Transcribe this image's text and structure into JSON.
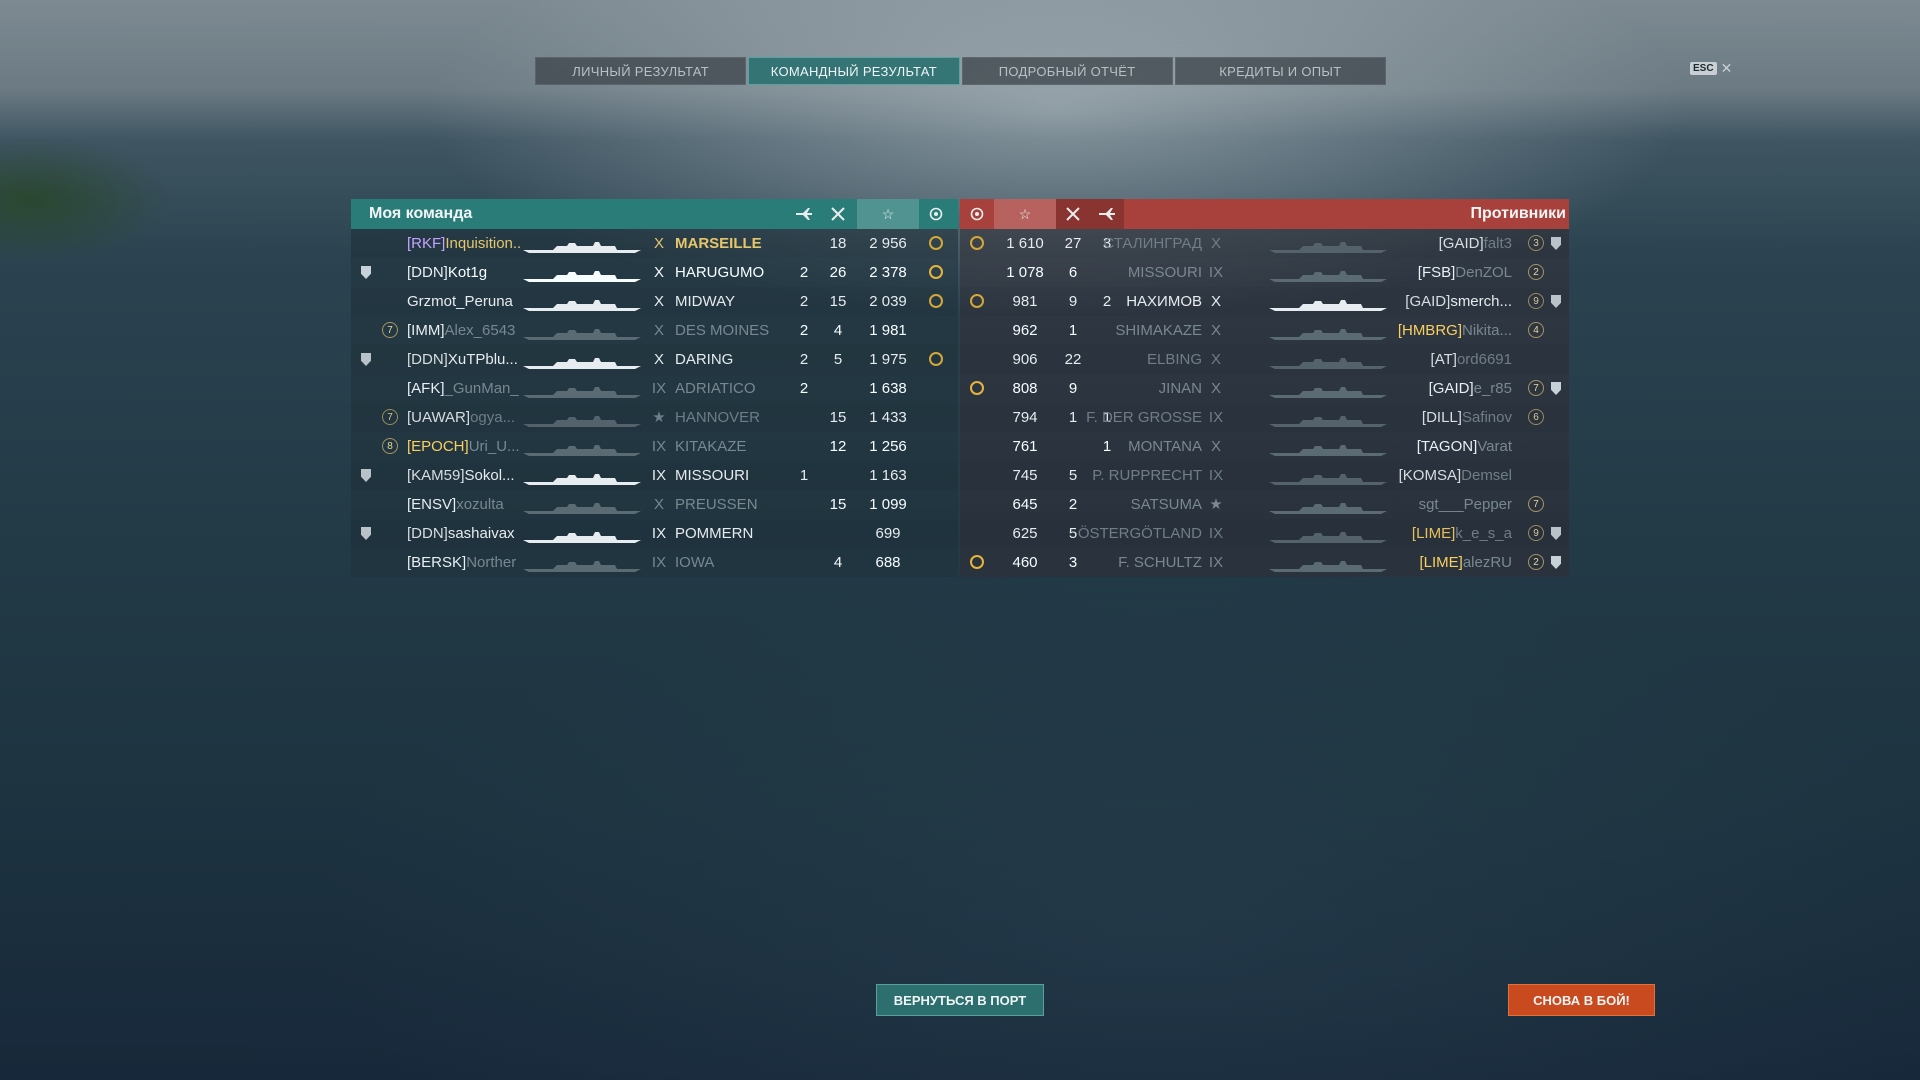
{
  "tabs": [
    "ЛИЧНЫЙ РЕЗУЛЬТАТ",
    "КОМАНДНЫЙ РЕЗУЛЬТАТ",
    "ПОДРОБНЫЙ ОТЧЁТ",
    "КРЕДИТЫ И ОПЫТ"
  ],
  "active_tab": 1,
  "esc": {
    "key": "ESC",
    "close": "✕"
  },
  "my_team": {
    "title": "Моя команда",
    "headers": {
      "planes_icon": "plane-icon",
      "frags_icon": "crossed-swords-icon",
      "xp_icon": "star-icon",
      "medal_icon": "medal-icon"
    },
    "rows": [
      {
        "clan": "[RKF]",
        "name": "Inquisition...",
        "tier": "X",
        "ship": "MARSEILLE",
        "planes": "",
        "frags": "18",
        "xp": "2 956",
        "medal": true,
        "style": "highlight",
        "left_icon": "",
        "dimmed": false
      },
      {
        "clan": "[DDN]",
        "name": "Kot1g",
        "tier": "X",
        "ship": "HARUGUMO",
        "planes": "2",
        "frags": "26",
        "xp": "2 378",
        "medal": true,
        "style": "",
        "left_icon": "shield",
        "dimmed": false
      },
      {
        "clan": "",
        "name": "Grzmot_Peruna",
        "tier": "X",
        "ship": "MIDWAY",
        "planes": "2",
        "frags": "15",
        "xp": "2 039",
        "medal": true,
        "style": "",
        "left_icon": "",
        "dimmed": false
      },
      {
        "clan": "[IMM]",
        "name": "Alex_6543",
        "tier": "X",
        "ship": "DES MOINES",
        "planes": "2",
        "frags": "4",
        "xp": "1 981",
        "medal": false,
        "style": "",
        "left_icon": "badge-7",
        "dimmed": true
      },
      {
        "clan": "[DDN]",
        "name": "XuTPblu...",
        "tier": "X",
        "ship": "DARING",
        "planes": "2",
        "frags": "5",
        "xp": "1 975",
        "medal": true,
        "style": "",
        "left_icon": "shield",
        "dimmed": false
      },
      {
        "clan": "[AFK]",
        "name": "_GunMan_",
        "tier": "IX",
        "ship": "ADRIATICO",
        "planes": "2",
        "frags": "",
        "xp": "1 638",
        "medal": false,
        "style": "",
        "left_icon": "",
        "dimmed": true
      },
      {
        "clan": "[UAWAR]",
        "name": "ogya...",
        "tier": "★",
        "ship": "HANNOVER",
        "planes": "",
        "frags": "15",
        "xp": "1 433",
        "medal": false,
        "style": "",
        "left_icon": "badge-7",
        "dimmed": true
      },
      {
        "clan": "[EPOCH]",
        "name": "Uri_U...",
        "tier": "IX",
        "ship": "KITAKAZE",
        "planes": "",
        "frags": "12",
        "xp": "1 256",
        "medal": false,
        "style": "yellowclan",
        "left_icon": "badge-8",
        "dimmed": true
      },
      {
        "clan": "[KAM59]",
        "name": "Sokol...",
        "tier": "IX",
        "ship": "MISSOURI",
        "planes": "1",
        "frags": "",
        "xp": "1 163",
        "medal": false,
        "style": "",
        "left_icon": "shield",
        "dimmed": false
      },
      {
        "clan": "[ENSV]",
        "name": "xozulta",
        "tier": "X",
        "ship": "PREUSSEN",
        "planes": "",
        "frags": "15",
        "xp": "1 099",
        "medal": false,
        "style": "",
        "left_icon": "",
        "dimmed": true
      },
      {
        "clan": "[DDN]",
        "name": "sashaivax",
        "tier": "IX",
        "ship": "POMMERN",
        "planes": "",
        "frags": "",
        "xp": "699",
        "medal": false,
        "style": "",
        "left_icon": "shield",
        "dimmed": false
      },
      {
        "clan": "[BERSK]",
        "name": "Norther",
        "tier": "IX",
        "ship": "IOWA",
        "planes": "",
        "frags": "4",
        "xp": "688",
        "medal": false,
        "style": "",
        "left_icon": "",
        "dimmed": true
      }
    ]
  },
  "enemies": {
    "title": "Противники",
    "rows": [
      {
        "medal": true,
        "xp": "1 610",
        "frags": "27",
        "planes": "3",
        "ship": "СТАЛИНГРАД",
        "tier": "X",
        "clan": "[GAID]",
        "name": "falt3",
        "badge": "3",
        "shield": true,
        "dimmed": true,
        "clan_style": ""
      },
      {
        "medal": false,
        "xp": "1 078",
        "frags": "6",
        "planes": "",
        "ship": "MISSOURI",
        "tier": "IX",
        "clan": "[FSB]",
        "name": "DenZOL",
        "badge": "2",
        "shield": false,
        "dimmed": true,
        "clan_style": ""
      },
      {
        "medal": true,
        "xp": "981",
        "frags": "9",
        "planes": "2",
        "ship": "НАХИМОВ",
        "tier": "X",
        "clan": "[GAID]",
        "name": "smerch...",
        "badge": "9",
        "shield": true,
        "dimmed": false,
        "clan_style": ""
      },
      {
        "medal": false,
        "xp": "962",
        "frags": "1",
        "planes": "",
        "ship": "SHIMAKAZE",
        "tier": "X",
        "clan": "[HMBRG]",
        "name": "Nikita...",
        "badge": "4",
        "shield": false,
        "dimmed": true,
        "clan_style": "gold"
      },
      {
        "medal": false,
        "xp": "906",
        "frags": "22",
        "planes": "",
        "ship": "ELBING",
        "tier": "X",
        "clan": "[AT]",
        "name": "ord6691",
        "badge": "",
        "shield": false,
        "dimmed": true,
        "clan_style": ""
      },
      {
        "medal": true,
        "xp": "808",
        "frags": "9",
        "planes": "",
        "ship": "JINAN",
        "tier": "X",
        "clan": "[GAID]",
        "name": "e_r85",
        "badge": "7",
        "shield": true,
        "dimmed": true,
        "clan_style": ""
      },
      {
        "medal": false,
        "xp": "794",
        "frags": "1",
        "planes": "1",
        "ship": "F. DER GROSSE",
        "tier": "IX",
        "clan": "[DILL]",
        "name": "Safinov",
        "badge": "6",
        "shield": false,
        "dimmed": true,
        "clan_style": ""
      },
      {
        "medal": false,
        "xp": "761",
        "frags": "",
        "planes": "1",
        "ship": "MONTANA",
        "tier": "X",
        "clan": "[TAGON]",
        "name": "Varat",
        "badge": "",
        "shield": false,
        "dimmed": true,
        "clan_style": ""
      },
      {
        "medal": false,
        "xp": "745",
        "frags": "5",
        "planes": "",
        "ship": "P. RUPPRECHT",
        "tier": "IX",
        "clan": "[KOMSA]",
        "name": "Demsel",
        "badge": "",
        "shield": false,
        "dimmed": true,
        "clan_style": ""
      },
      {
        "medal": false,
        "xp": "645",
        "frags": "2",
        "planes": "",
        "ship": "SATSUMA",
        "tier": "★",
        "clan": "",
        "name": "sgt___Pepper",
        "badge": "7",
        "shield": false,
        "dimmed": true,
        "clan_style": ""
      },
      {
        "medal": false,
        "xp": "625",
        "frags": "5",
        "planes": "",
        "ship": "ÖSTERGÖTLAND",
        "tier": "IX",
        "clan": "[LIME]",
        "name": "k_e_s_a",
        "badge": "9",
        "shield": true,
        "dimmed": true,
        "clan_style": "gold"
      },
      {
        "medal": true,
        "xp": "460",
        "frags": "3",
        "planes": "",
        "ship": "F. SCHULTZ",
        "tier": "IX",
        "clan": "[LIME]",
        "name": "alezRU",
        "badge": "2",
        "shield": true,
        "dimmed": true,
        "clan_style": "gold"
      }
    ]
  },
  "buttons": {
    "port": "ВЕРНУТЬСЯ В ПОРТ",
    "battle": "СНОВА В БОЙ!"
  },
  "colors": {
    "team_header": "#2a7c78",
    "enemy_header": "#a8403c",
    "battle_button": "#c84a1e",
    "port_button": "#2c6f6e"
  }
}
